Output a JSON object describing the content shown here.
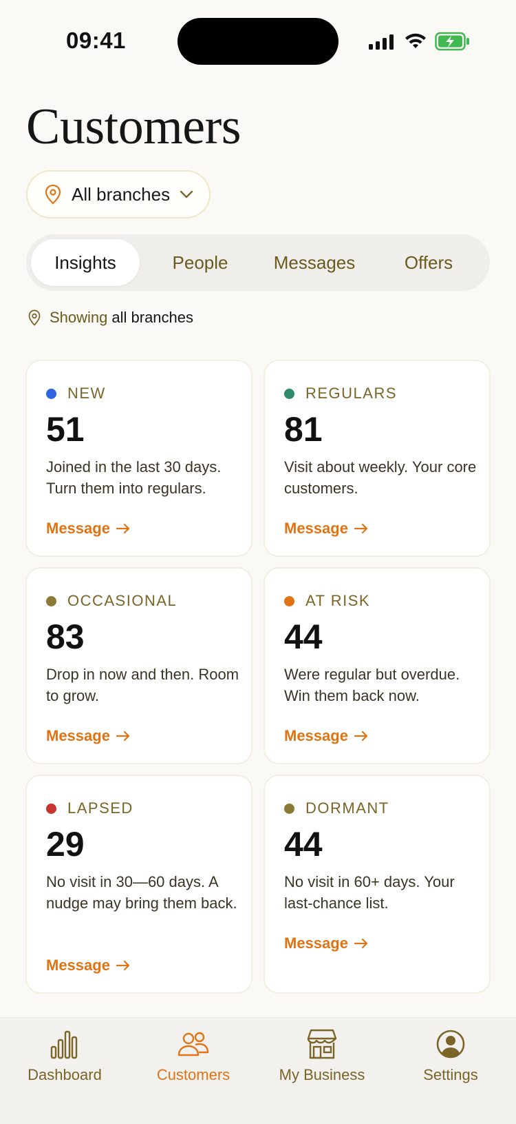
{
  "status_bar": {
    "time": "09:41"
  },
  "header": {
    "title": "Customers"
  },
  "branch_selector": {
    "label": "All branches",
    "icon": "location-pin-icon"
  },
  "tabs": [
    {
      "label": "Insights",
      "active": true
    },
    {
      "label": "People",
      "active": false
    },
    {
      "label": "Messages",
      "active": false
    },
    {
      "label": "Offers",
      "active": false
    }
  ],
  "showing": {
    "prefix": "Showing",
    "value": "all branches"
  },
  "colors": {
    "accent": "#e07414",
    "olive": "#7a6428",
    "new": "#2f63e0",
    "regulars": "#2e8a6a",
    "occasional": "#8a7a36",
    "at_risk": "#e07414",
    "lapsed": "#c8362f",
    "dormant": "#8a7a36"
  },
  "segments": [
    {
      "tag": "NEW",
      "count": "51",
      "description": "Joined in the last 30 days. Turn them into regulars.",
      "action": "Message"
    },
    {
      "tag": "REGULARS",
      "count": "81",
      "description": "Visit about weekly. Your core customers.",
      "action": "Message"
    },
    {
      "tag": "OCCASIONAL",
      "count": "83",
      "description": "Drop in now and then. Room to grow.",
      "action": "Message"
    },
    {
      "tag": "AT RISK",
      "count": "44",
      "description": "Were regular but overdue. Win them back now.",
      "action": "Message"
    },
    {
      "tag": "LAPSED",
      "count": "29",
      "description": "No visit in 30—60 days. A nudge may bring them back.",
      "action": "Message"
    },
    {
      "tag": "DORMANT",
      "count": "44",
      "description": "No visit in 60+ days. Your last-chance list.",
      "action": "Message"
    }
  ],
  "tabbar": [
    {
      "label": "Dashboard",
      "icon": "bar-chart-icon",
      "active": false
    },
    {
      "label": "Customers",
      "icon": "users-icon",
      "active": true
    },
    {
      "label": "My Business",
      "icon": "storefront-icon",
      "active": false
    },
    {
      "label": "Settings",
      "icon": "user-circle-icon",
      "active": false
    }
  ]
}
